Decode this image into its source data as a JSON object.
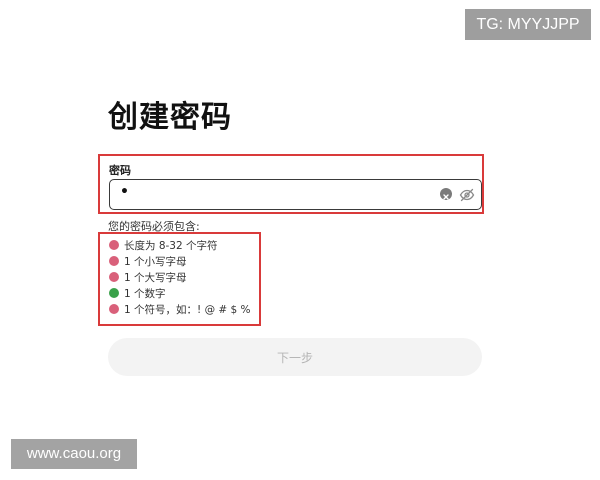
{
  "watermark_top": "TG: MYYJJPP",
  "watermark_bottom": "www.caou.org",
  "page_title": "创建密码",
  "password_field": {
    "label": "密码",
    "value": "•"
  },
  "requirements": {
    "title": "您的密码必须包含:",
    "items": [
      {
        "text": "长度为 8-32 个字符",
        "met": false
      },
      {
        "text": "1 个小写字母",
        "met": false
      },
      {
        "text": "1 个大写字母",
        "met": false
      },
      {
        "text": "1 个数字",
        "met": true
      },
      {
        "text": "1 个符号，如：! @ # $ %",
        "met": false
      }
    ]
  },
  "next_button_label": "下一步",
  "colors": {
    "highlight_border": "#d93a3a",
    "status_fail": "#d9607a",
    "status_pass": "#3aa14a"
  },
  "icons": {
    "clear": "clear-icon",
    "toggle_visibility": "eye-off-icon"
  }
}
